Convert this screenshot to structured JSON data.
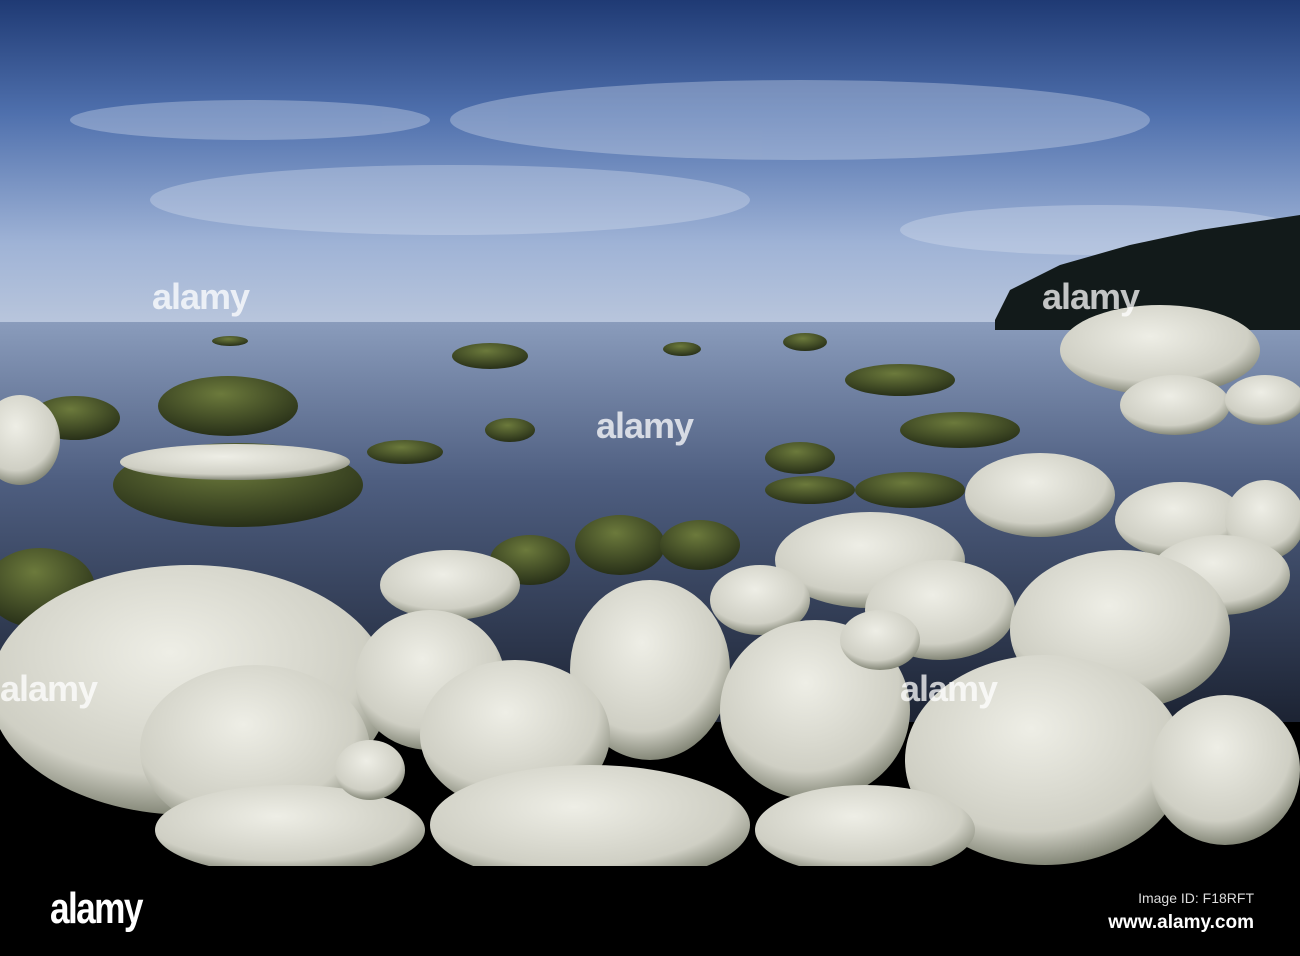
{
  "photo": {
    "subject": "boulder-shore",
    "colors": {
      "sky_top": "#2b4a86",
      "sky_mid": "#7f9cc9",
      "horizon": "#b9c7de",
      "water": "#4e5e7e",
      "rock_light": "#dcdcd4",
      "rock_moss": "#4d5a2e"
    }
  },
  "watermark": {
    "text": "alamy"
  },
  "footer": {
    "logo": "alamy",
    "image_id": "Image ID: F18RFT",
    "url": "www.alamy.com"
  }
}
